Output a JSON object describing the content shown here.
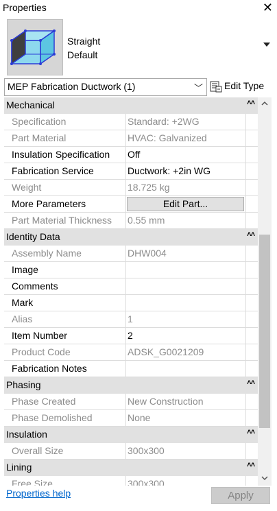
{
  "panel": {
    "title": "Properties"
  },
  "type_selector": {
    "line1": "Straight",
    "line2": "Default"
  },
  "instance_selector": {
    "value": "MEP Fabrication Ductwork (1)"
  },
  "edit_type": {
    "label": "Edit Type"
  },
  "sections": [
    {
      "label": "Mechanical",
      "props": [
        {
          "name": "Specification",
          "value": "Standard: +2WG",
          "readonly": true
        },
        {
          "name": "Part Material",
          "value": "HVAC: Galvanized",
          "readonly": true
        },
        {
          "name": "Insulation Specification",
          "value": "Off",
          "readonly": false
        },
        {
          "name": "Fabrication Service",
          "value": "Ductwork: +2in WG",
          "readonly": false
        },
        {
          "name": "Weight",
          "value": "18.725 kg",
          "readonly": true
        },
        {
          "name": "More Parameters",
          "button": "Edit Part...",
          "readonly": false
        },
        {
          "name": "Part Material Thickness",
          "value": "0.55 mm",
          "readonly": true
        }
      ]
    },
    {
      "label": "Identity Data",
      "props": [
        {
          "name": "Assembly Name",
          "value": "DHW004",
          "readonly": true
        },
        {
          "name": "Image",
          "value": "",
          "readonly": false
        },
        {
          "name": "Comments",
          "value": "",
          "readonly": false
        },
        {
          "name": "Mark",
          "value": "",
          "readonly": false
        },
        {
          "name": "Alias",
          "value": "1",
          "readonly": true
        },
        {
          "name": "Item Number",
          "value": "2",
          "readonly": false
        },
        {
          "name": "Product Code",
          "value": "ADSK_G0021209",
          "readonly": true
        },
        {
          "name": "Fabrication Notes",
          "value": "",
          "readonly": false
        }
      ]
    },
    {
      "label": "Phasing",
      "props": [
        {
          "name": "Phase Created",
          "value": "New Construction",
          "readonly": true
        },
        {
          "name": "Phase Demolished",
          "value": "None",
          "readonly": true
        }
      ]
    },
    {
      "label": "Insulation",
      "props": [
        {
          "name": "Overall Size",
          "value": "300x300",
          "readonly": true
        }
      ]
    },
    {
      "label": "Lining",
      "props": [
        {
          "name": "Free Size",
          "value": "300x300",
          "readonly": true
        }
      ]
    }
  ],
  "footer": {
    "help_label": "Properties help",
    "apply_label": "Apply"
  },
  "colors": {
    "header_bg": "#e1e1e1",
    "readonly_text": "#8c8c8c",
    "link": "#0066cc"
  },
  "icons": {
    "close": "close-icon",
    "collapse": "double-chevron-up-icon",
    "duct": "rectangular-duct-icon",
    "edit_type": "edit-type-icon"
  }
}
